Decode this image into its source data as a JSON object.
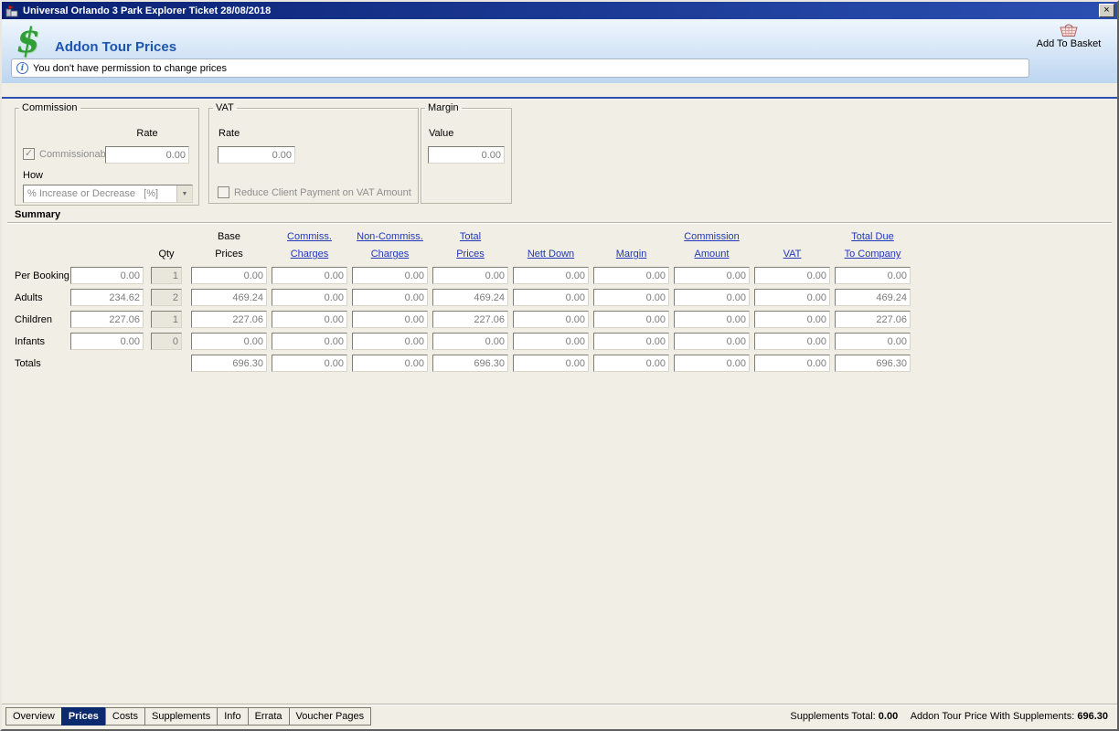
{
  "window": {
    "title": "Universal Orlando 3 Park Explorer Ticket 28/08/2018"
  },
  "icons": {
    "close_glyph": "×",
    "dollar_glyph": "$",
    "info_glyph": "i",
    "dropdown_glyph": "▼",
    "check_glyph": "✓"
  },
  "header": {
    "title": "Addon Tour Prices",
    "add_to_basket": "Add To Basket",
    "notice": "You don't have permission to change prices"
  },
  "panels": {
    "commission": {
      "label": "Commission",
      "rate_label": "Rate",
      "rate_value": "0.00",
      "commissionable_label": "Commissionable",
      "commissionable_checked": true,
      "how_label": "How",
      "how_value": "% Increase or Decrease   [%]"
    },
    "vat": {
      "label": "VAT",
      "rate_label": "Rate",
      "rate_value": "0.00",
      "reduce_label": "Reduce Client Payment on VAT Amount",
      "reduce_checked": false
    },
    "margin": {
      "label": "Margin",
      "value_label": "Value",
      "value": "0.00"
    }
  },
  "summary": {
    "label": "Summary",
    "columns": [
      {
        "line1": "",
        "line2": "Qty",
        "link": false
      },
      {
        "line1": "Base",
        "line2": "Prices",
        "link": false
      },
      {
        "line1": "Commiss.",
        "line2": "Charges",
        "link": true
      },
      {
        "line1": "Non-Commiss.",
        "line2": "Charges",
        "link": true
      },
      {
        "line1": "Total",
        "line2": "Prices",
        "link": true
      },
      {
        "line1": "",
        "line2": "Nett Down",
        "link": true
      },
      {
        "line1": "",
        "line2": "Margin",
        "link": true
      },
      {
        "line1": "Commission",
        "line2": "Amount",
        "link": true
      },
      {
        "line1": "",
        "line2": "VAT",
        "link": true
      },
      {
        "line1": "Total Due",
        "line2": "To Company",
        "link": true
      }
    ],
    "rows": [
      {
        "label": "Per Booking",
        "price": "0.00",
        "qty": "1",
        "cells": [
          "0.00",
          "0.00",
          "0.00",
          "0.00",
          "0.00",
          "0.00",
          "0.00",
          "0.00",
          "0.00"
        ]
      },
      {
        "label": "Adults",
        "price": "234.62",
        "qty": "2",
        "cells": [
          "469.24",
          "0.00",
          "0.00",
          "469.24",
          "0.00",
          "0.00",
          "0.00",
          "0.00",
          "469.24"
        ]
      },
      {
        "label": "Children",
        "price": "227.06",
        "qty": "1",
        "cells": [
          "227.06",
          "0.00",
          "0.00",
          "227.06",
          "0.00",
          "0.00",
          "0.00",
          "0.00",
          "227.06"
        ]
      },
      {
        "label": "Infants",
        "price": "0.00",
        "qty": "0",
        "cells": [
          "0.00",
          "0.00",
          "0.00",
          "0.00",
          "0.00",
          "0.00",
          "0.00",
          "0.00",
          "0.00"
        ]
      },
      {
        "label": "Totals",
        "price": null,
        "qty": null,
        "cells": [
          "696.30",
          "0.00",
          "0.00",
          "696.30",
          "0.00",
          "0.00",
          "0.00",
          "0.00",
          "696.30"
        ]
      }
    ]
  },
  "tabs": [
    {
      "label": "Overview",
      "active": false
    },
    {
      "label": "Prices",
      "active": true
    },
    {
      "label": "Costs",
      "active": false
    },
    {
      "label": "Supplements",
      "active": false
    },
    {
      "label": "Info",
      "active": false
    },
    {
      "label": "Errata",
      "active": false
    },
    {
      "label": "Voucher Pages",
      "active": false
    }
  ],
  "status": {
    "supplements_total_label": "Supplements Total:",
    "supplements_total_value": "0.00",
    "with_supplements_label": "Addon Tour Price With Supplements:",
    "with_supplements_value": "696.30"
  }
}
